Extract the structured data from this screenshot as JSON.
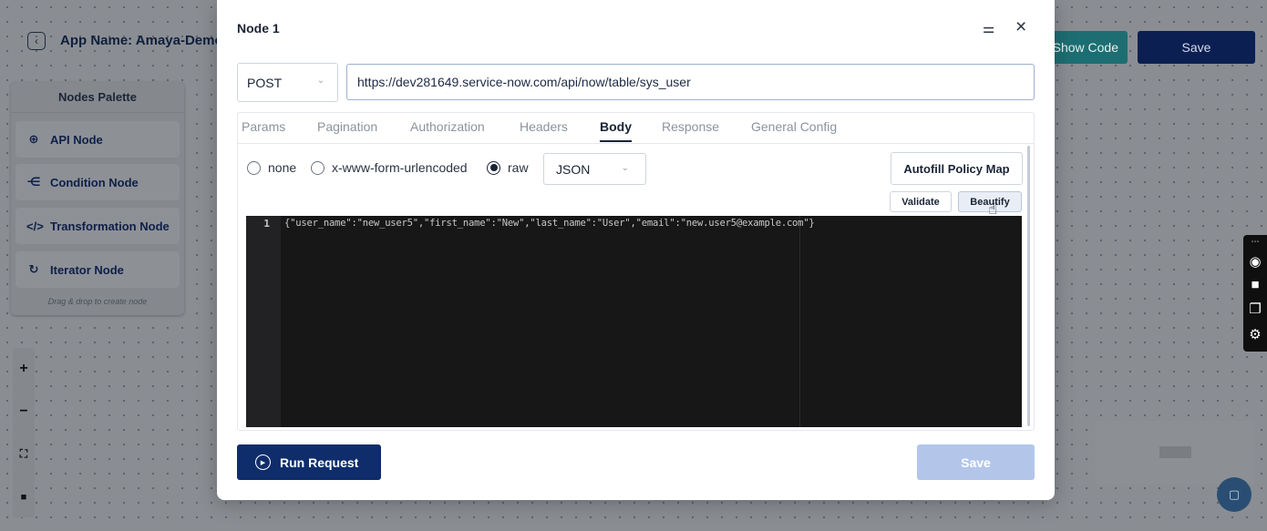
{
  "app": {
    "name": "App Name: Amaya-Demo",
    "show_code_label": "Show Code",
    "save_label": "Save"
  },
  "palette": {
    "title": "Nodes Palette",
    "items": [
      {
        "label": "API Node",
        "icon": "globe-icon"
      },
      {
        "label": "Condition Node",
        "icon": "branch-icon"
      },
      {
        "label": "Transformation Node",
        "icon": "code-icon"
      },
      {
        "label": "Iterator Node",
        "icon": "loop-icon"
      }
    ],
    "hint": "Drag & drop to create node"
  },
  "zoom_controls": {
    "zoom_in": "+",
    "zoom_out": "−",
    "fit": "⛶",
    "lock": "🔒"
  },
  "modal": {
    "title": "Node 1",
    "method": "POST",
    "url": "https://dev281649.service-now.com/api/now/table/sys_user",
    "tabs": [
      {
        "label": "Params",
        "active": false
      },
      {
        "label": "Pagination",
        "active": false
      },
      {
        "label": "Authorization",
        "active": false
      },
      {
        "label": "Headers",
        "active": false
      },
      {
        "label": "Body",
        "active": true
      },
      {
        "label": "Response",
        "active": false
      },
      {
        "label": "General Config",
        "active": false
      }
    ],
    "body_types": [
      {
        "label": "none",
        "selected": false
      },
      {
        "label": "x-www-form-urlencoded",
        "selected": false
      },
      {
        "label": "raw",
        "selected": true
      }
    ],
    "format": "JSON",
    "autofill_label": "Autofill Policy Map",
    "validate_label": "Validate",
    "beautify_label": "Beautify",
    "editor": {
      "line_number": "1",
      "line1": "{\"user_name\":\"new_user5\",\"first_name\":\"New\",\"last_name\":\"User\",\"email\":\"new.user5@example.com\"}"
    },
    "run_label": "Run Request",
    "save_label": "Save"
  },
  "colors": {
    "primary": "#0f2d6b",
    "save_disabled": "#b3c6ea",
    "accent_teal": "#1d6e72"
  }
}
